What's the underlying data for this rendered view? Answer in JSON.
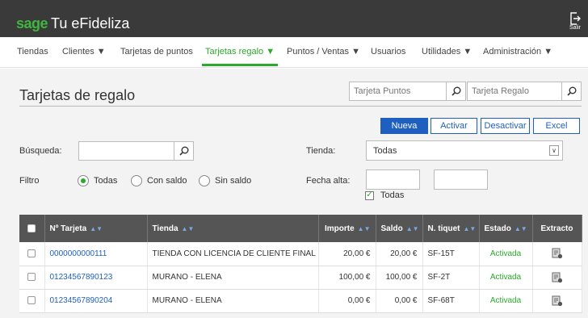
{
  "brand": {
    "sage": "sage",
    "app": "Tu eFideliza"
  },
  "logout": {
    "label": "Salir"
  },
  "nav": {
    "items": [
      {
        "label": "Tiendas"
      },
      {
        "label": "Clientes ▼"
      },
      {
        "label": "Tarjetas de puntos"
      },
      {
        "label": "Tarjetas regalo ▼"
      },
      {
        "label": "Puntos / Ventas ▼"
      },
      {
        "label": "Usuarios"
      },
      {
        "label": "Utilidades ▼"
      },
      {
        "label": "Administración ▼"
      }
    ]
  },
  "page": {
    "title": "Tarjetas de regalo"
  },
  "quick_search": {
    "points_placeholder": "Tarjeta Puntos",
    "gift_placeholder": "Tarjeta Regalo"
  },
  "actions": {
    "new": "Nueva",
    "activate": "Activar",
    "deactivate": "Desactivar",
    "excel": "Excel"
  },
  "filters": {
    "search_label": "Búsqueda:",
    "search_value": "",
    "store_label": "Tienda:",
    "store_value": "Todas",
    "filter_label": "Filtro",
    "options": [
      "Todas",
      "Con saldo",
      "Sin saldo"
    ],
    "selected": "Todas",
    "date_label": "Fecha alta:",
    "date_from": "",
    "date_to": "",
    "all_dates_label": "Todas",
    "all_dates_checked": true
  },
  "table": {
    "columns": [
      "Nº Tarjeta",
      "Tienda",
      "Importe",
      "Saldo",
      "N. tiquet",
      "Estado",
      "Extracto"
    ],
    "rows": [
      {
        "card": "0000000000111",
        "store": "TIENDA CON LICENCIA DE CLIENTE FINAL",
        "amount": "20,00 €",
        "balance": "20,00 €",
        "ticket": "SF-15T",
        "status": "Activada"
      },
      {
        "card": "01234567890123",
        "store": "MURANO - ELENA",
        "amount": "100,00 €",
        "balance": "100,00 €",
        "ticket": "SF-2T",
        "status": "Activada"
      },
      {
        "card": "01234567890204",
        "store": "MURANO - ELENA",
        "amount": "0,00 €",
        "balance": "0,00 €",
        "ticket": "SF-68T",
        "status": "Activada"
      }
    ]
  },
  "colors": {
    "accent": "#2aaa2a",
    "primary": "#1f5fbf",
    "header": "#3a3a3a",
    "grid_header": "#555555"
  }
}
